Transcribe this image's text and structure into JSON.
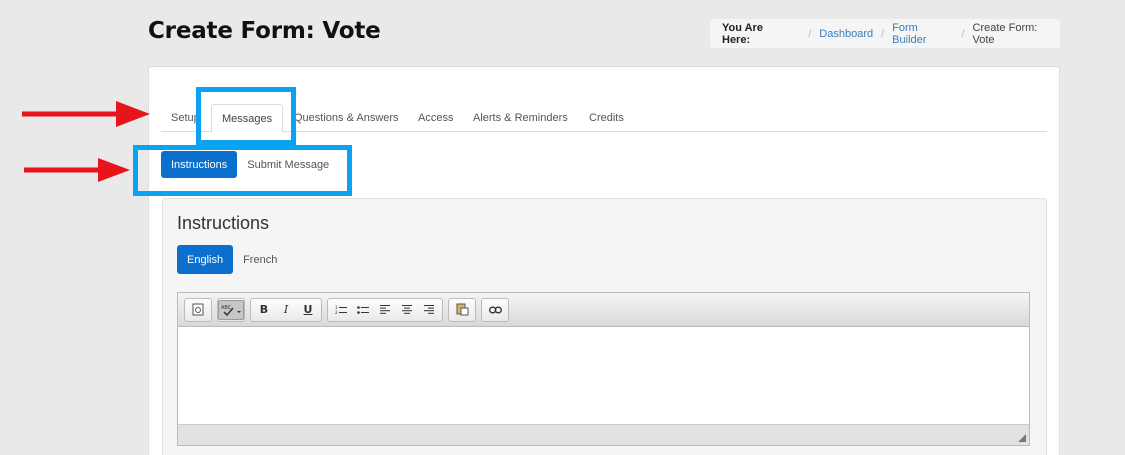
{
  "page": {
    "title": "Create Form: Vote"
  },
  "breadcrumb": {
    "label": "You Are Here:",
    "items": [
      "Dashboard",
      "Form Builder",
      "Create Form: Vote"
    ]
  },
  "tabs": [
    {
      "label": "Setup"
    },
    {
      "label": "Messages",
      "active": true
    },
    {
      "label": "Questions & Answers"
    },
    {
      "label": "Access"
    },
    {
      "label": "Alerts & Reminders"
    },
    {
      "label": "Credits"
    }
  ],
  "subtabs": [
    {
      "label": "Instructions",
      "active": true
    },
    {
      "label": "Submit Message"
    }
  ],
  "panel": {
    "title": "Instructions",
    "languages": [
      {
        "label": "English",
        "active": true
      },
      {
        "label": "French"
      }
    ]
  },
  "editor": {
    "toolbar": {
      "bold": "B",
      "italic": "I",
      "underline": "U",
      "spellcheck": "ABC"
    }
  },
  "colors": {
    "accent": "#0b6fce",
    "highlight": "#0aa2f2",
    "arrow": "#e8141c",
    "link": "#3a7bbf"
  }
}
